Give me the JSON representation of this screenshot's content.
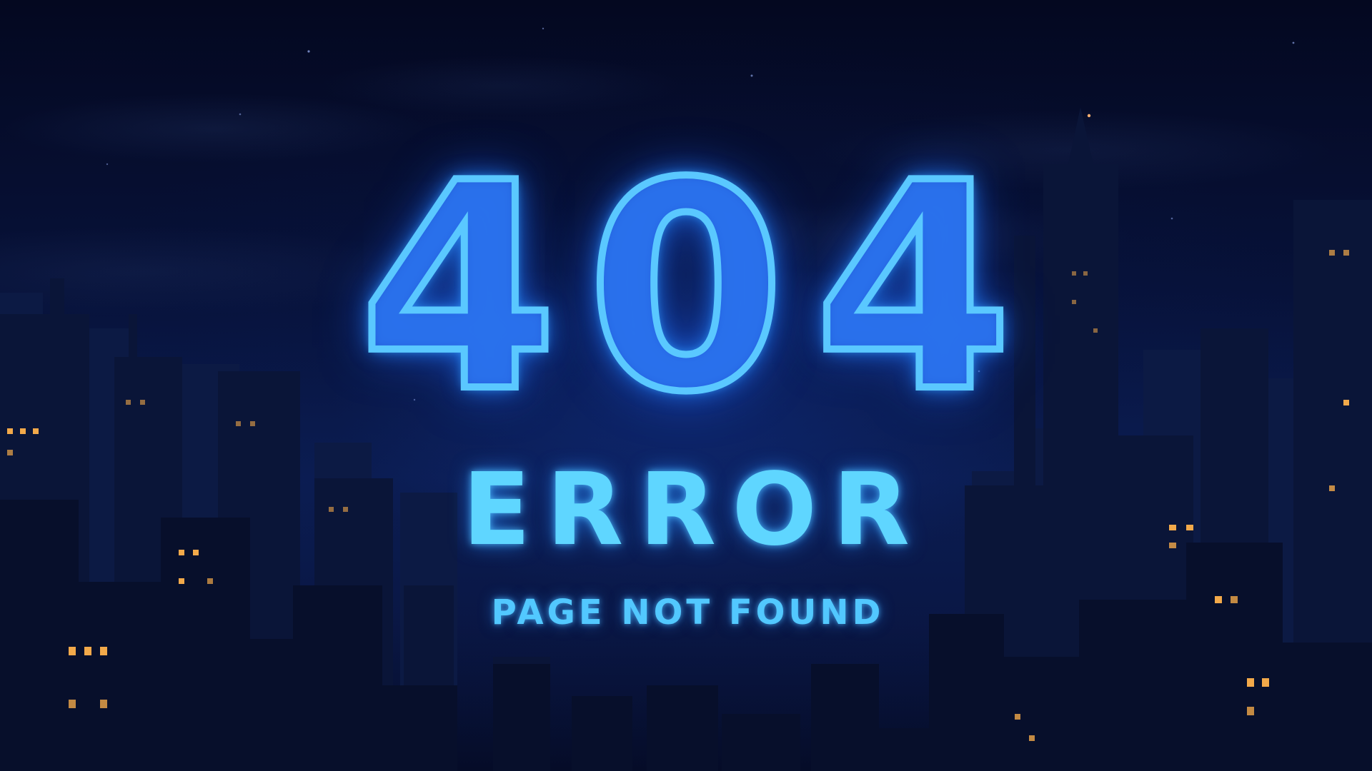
{
  "error_page": {
    "code": "404",
    "title": "ERROR",
    "subtitle": "PAGE NOT FOUND"
  },
  "colors": {
    "neon_stroke": "#5ac8ff",
    "neon_fill": "#1e46dc",
    "error_text": "#5fd6ff",
    "subtitle_text": "#52c8ff",
    "sky_top": "#040820",
    "sky_mid": "#0b1d52",
    "window_light": "#f2a94a"
  },
  "icons": {
    "background": "night-city-skyline-illustration"
  }
}
